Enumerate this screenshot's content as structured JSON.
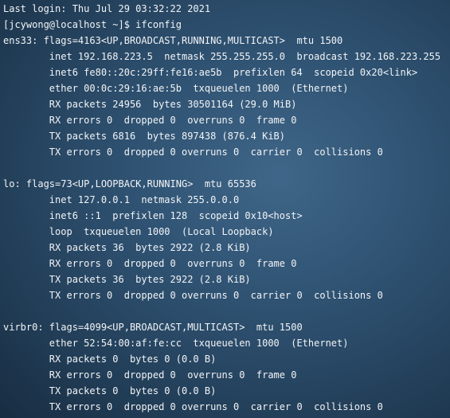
{
  "terminal": {
    "lines": [
      "Last login: Thu Jul 29 03:32:22 2021",
      "[jcywong@localhost ~]$ ifconfig",
      "ens33: flags=4163<UP,BROADCAST,RUNNING,MULTICAST>  mtu 1500",
      "        inet 192.168.223.5  netmask 255.255.255.0  broadcast 192.168.223.255",
      "        inet6 fe80::20c:29ff:fe16:ae5b  prefixlen 64  scopeid 0x20<link>",
      "        ether 00:0c:29:16:ae:5b  txqueuelen 1000  (Ethernet)",
      "        RX packets 24956  bytes 30501164 (29.0 MiB)",
      "        RX errors 0  dropped 0  overruns 0  frame 0",
      "        TX packets 6816  bytes 897438 (876.4 KiB)",
      "        TX errors 0  dropped 0 overruns 0  carrier 0  collisions 0",
      "",
      "lo: flags=73<UP,LOOPBACK,RUNNING>  mtu 65536",
      "        inet 127.0.0.1  netmask 255.0.0.0",
      "        inet6 ::1  prefixlen 128  scopeid 0x10<host>",
      "        loop  txqueuelen 1000  (Local Loopback)",
      "        RX packets 36  bytes 2922 (2.8 KiB)",
      "        RX errors 0  dropped 0  overruns 0  frame 0",
      "        TX packets 36  bytes 2922 (2.8 KiB)",
      "        TX errors 0  dropped 0 overruns 0  carrier 0  collisions 0",
      "",
      "virbr0: flags=4099<UP,BROADCAST,MULTICAST>  mtu 1500",
      "        ether 52:54:00:af:fe:cc  txqueuelen 1000  (Ethernet)",
      "        RX packets 0  bytes 0 (0.0 B)",
      "        RX errors 0  dropped 0  overruns 0  frame 0",
      "        TX packets 0  bytes 0 (0.0 B)",
      "        TX errors 0  dropped 0 overruns 0  carrier 0  collisions 0"
    ]
  },
  "colors": {
    "text": "#f2f4f6",
    "background": "#2f5272"
  }
}
